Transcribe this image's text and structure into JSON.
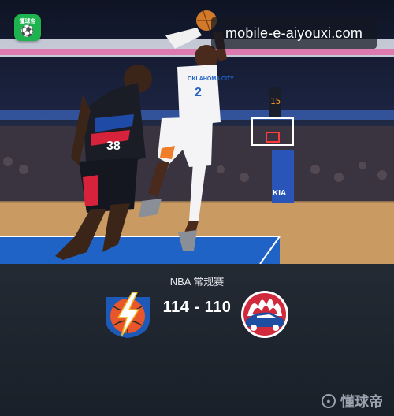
{
  "app_badge": {
    "label": "懂球帝",
    "icon": "soccer-ball-icon"
  },
  "watermark": {
    "text": "mobile-e-aiyouxi.com"
  },
  "photo": {
    "description_icon": "basketball-action-photo",
    "jersey_left_text": "38",
    "jersey_right_team": "OKLAHOMA CITY",
    "jersey_right_number": "2",
    "arena_sign": "KIA"
  },
  "match": {
    "league": "NBA 常规赛",
    "score": "114 - 110",
    "home_logo": "thunder-logo-icon",
    "away_logo": "clippers-logo-icon"
  },
  "brand": {
    "name": "懂球帝",
    "icon": "dongqiudi-icon"
  },
  "colors": {
    "background": "#1c222b",
    "badge_green": "#1db34f",
    "thunder_orange": "#e8562a",
    "clippers_red": "#d12a3c",
    "clippers_blue": "#1d4ea1"
  }
}
